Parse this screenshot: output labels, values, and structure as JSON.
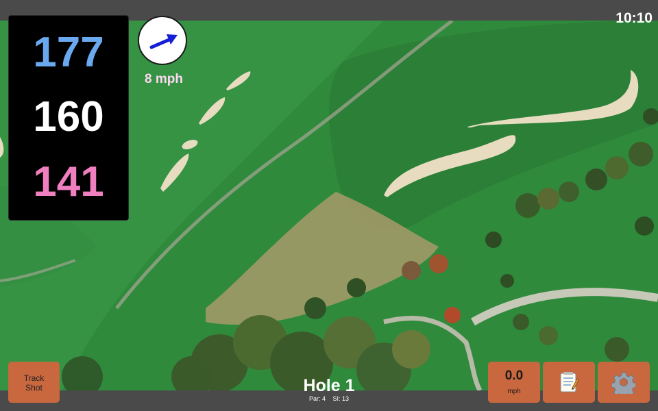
{
  "status_bar": {
    "clock": "10:10"
  },
  "distances": {
    "back": "177",
    "middle": "160",
    "front": "141"
  },
  "wind": {
    "speed_label": "8 mph",
    "direction_icon": "arrow-icon",
    "arrow_color": "#1520d6"
  },
  "hole": {
    "title": "Hole 1",
    "par_label": "Par: 4",
    "si_label": "SI: 13"
  },
  "buttons": {
    "track_shot_line1": "Track",
    "track_shot_line2": "Shot",
    "speed_value": "0.0",
    "speed_unit": "mph",
    "notes_icon": "notepad-icon",
    "settings_icon": "gear-icon"
  },
  "colors": {
    "button_bg": "#c9673f",
    "panel_bg": "#000000",
    "back_distance": "#6aa9f0",
    "middle_distance": "#ffffff",
    "front_distance": "#f07fc0",
    "bar_bg": "#4a4a4a"
  }
}
